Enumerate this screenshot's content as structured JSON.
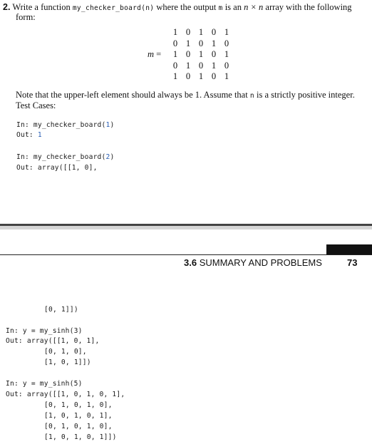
{
  "problem": {
    "number": "2.",
    "line1_pre": "Write a function ",
    "func_sig": "my_checker_board(n)",
    "line1_mid": " where the output ",
    "var_m": "m",
    "line1_is": " is an ",
    "dims": "n × n",
    "line1_post": " array with the following",
    "line2": "form:",
    "matrix_label": "m",
    "matrix_eq": " =",
    "matrix": [
      [
        "1",
        "0",
        "1",
        "0",
        "1"
      ],
      [
        "0",
        "1",
        "0",
        "1",
        "0"
      ],
      [
        "1",
        "0",
        "1",
        "0",
        "1"
      ],
      [
        "0",
        "1",
        "0",
        "1",
        "0"
      ],
      [
        "1",
        "0",
        "1",
        "0",
        "1"
      ]
    ],
    "note_pre": "Note that the upper-left element should always be 1. Assume that ",
    "note_n": "n",
    "note_post": " is a strictly positive integer.",
    "test_cases": "Test Cases:"
  },
  "tests_top": {
    "t1_in_label": "In: ",
    "t1_in_call": "my_checker_board(",
    "t1_in_arg": "1",
    "t1_in_close": ")",
    "t1_out_label": "Out: ",
    "t1_out_val": "1",
    "t2_in_label": "In: ",
    "t2_in_call": "my_checker_board(",
    "t2_in_arg": "2",
    "t2_in_close": ")",
    "t2_out_label": "Out: ",
    "t2_out_val": "array([[1, 0],"
  },
  "page_header": {
    "section_num": "3.6",
    "section_title": " SUMMARY AND PROBLEMS",
    "page_number": "73"
  },
  "tests_bottom": {
    "cont_line": "[0, 1]])",
    "a_in": "In: y = my_sinh(3)",
    "a_out1": "Out: array([[1, 0, 1],",
    "a_out2": "[0, 1, 0],",
    "a_out3": "[1, 0, 1]])",
    "b_in": "In: y = my_sinh(5)",
    "b_out1": "Out: array([[1, 0, 1, 0, 1],",
    "b_out2": "[0, 1, 0, 1, 0],",
    "b_out3": "[1, 0, 1, 0, 1],",
    "b_out4": "[0, 1, 0, 1, 0],",
    "b_out5": "[1, 0, 1, 0, 1]])"
  }
}
